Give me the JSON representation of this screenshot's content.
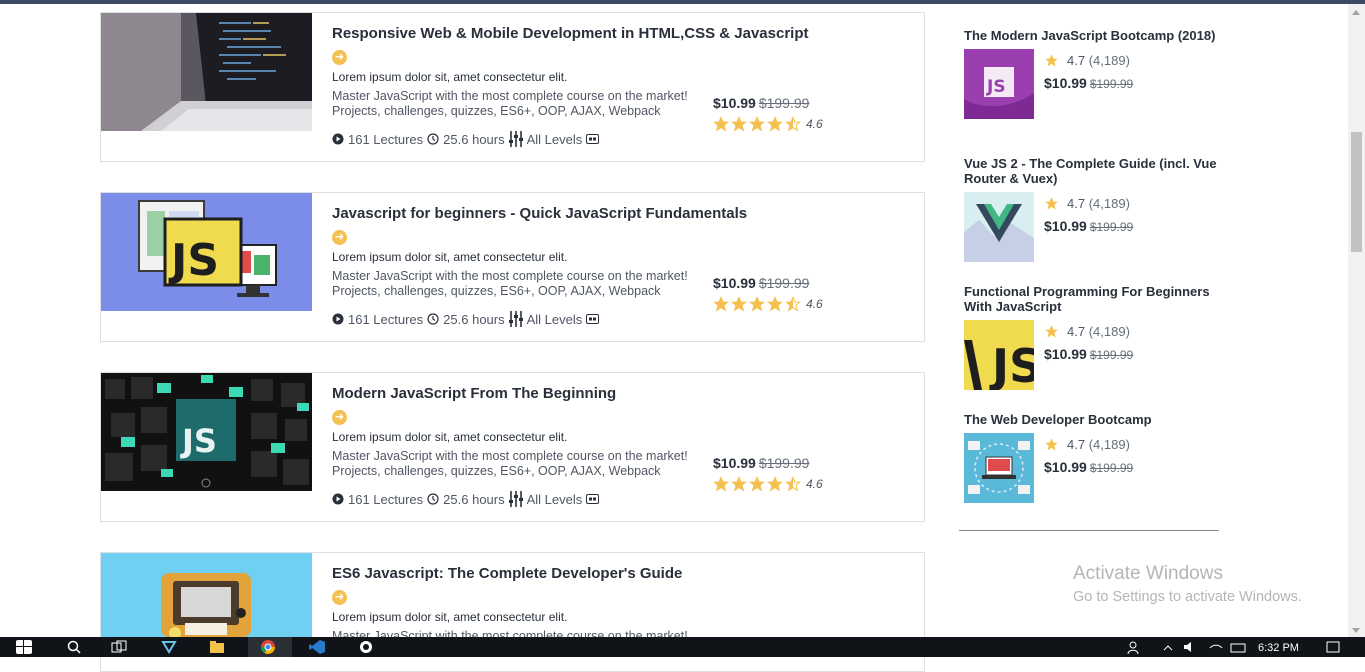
{
  "courses": [
    {
      "title": "Responsive Web & Mobile Development in HTML,CSS & Javascript",
      "subtitle": "Lorem ipsum dolor sit, amet consectetur elit.",
      "desc1": "Master JavaScript with the most complete course on the market!",
      "desc2": "Projects, challenges, quizzes, ES6+, OOP, AJAX, Webpack",
      "lectures": "161 Lectures",
      "hours": "25.6 hours",
      "level": "All Levels",
      "price": "$10.99",
      "old_price": "$199.99",
      "rating": "4.6",
      "stars": 4.5
    },
    {
      "title": "Javascript for beginners - Quick JavaScript Fundamentals",
      "subtitle": "Lorem ipsum dolor sit, amet consectetur elit.",
      "desc1": "Master JavaScript with the most complete course on the market!",
      "desc2": "Projects, challenges, quizzes, ES6+, OOP, AJAX, Webpack",
      "lectures": "161 Lectures",
      "hours": "25.6 hours",
      "level": "All Levels",
      "price": "$10.99",
      "old_price": "$199.99",
      "rating": "4.6",
      "stars": 4.5,
      "thumb_text": "JS"
    },
    {
      "title": "Modern JavaScript From The Beginning",
      "subtitle": "Lorem ipsum dolor sit, amet consectetur elit.",
      "desc1": "Master JavaScript with the most complete course on the market!",
      "desc2": "Projects, challenges, quizzes, ES6+, OOP, AJAX, Webpack",
      "lectures": "161 Lectures",
      "hours": "25.6 hours",
      "level": "All Levels",
      "price": "$10.99",
      "old_price": "$199.99",
      "rating": "4.6",
      "stars": 4.5,
      "thumb_text": "JS"
    },
    {
      "title": "ES6 Javascript: The Complete Developer's Guide",
      "subtitle": "Lorem ipsum dolor sit, amet consectetur elit.",
      "desc1": "Master JavaScript with the most complete course on the market!"
    }
  ],
  "sidebar": [
    {
      "title": "The Modern JavaScript Bootcamp (2018)",
      "rating": "4.7",
      "count": "(4,189)",
      "price": "$10.99",
      "old_price": "$199.99",
      "thumb_text": "JS"
    },
    {
      "title": "Vue JS 2 - The Complete Guide (incl. Vue Router & Vuex)",
      "rating": "4.7",
      "count": "(4,189)",
      "price": "$10.99",
      "old_price": "$199.99"
    },
    {
      "title": "Functional Programming For Beginners With JavaScript",
      "rating": "4.7",
      "count": "(4,189)",
      "price": "$10.99",
      "old_price": "$199.99",
      "thumb_text": "JS"
    },
    {
      "title": "The Web Developer Bootcamp",
      "rating": "4.7",
      "count": "(4,189)",
      "price": "$10.99",
      "old_price": "$199.99"
    }
  ],
  "watermark": {
    "line1": "Activate Windows",
    "line2": "Go to Settings to activate Windows."
  },
  "taskbar": {
    "clock": "6:32 PM"
  },
  "colors": {
    "star": "#f4c150",
    "text": "#29303b",
    "muted": "#505763"
  }
}
